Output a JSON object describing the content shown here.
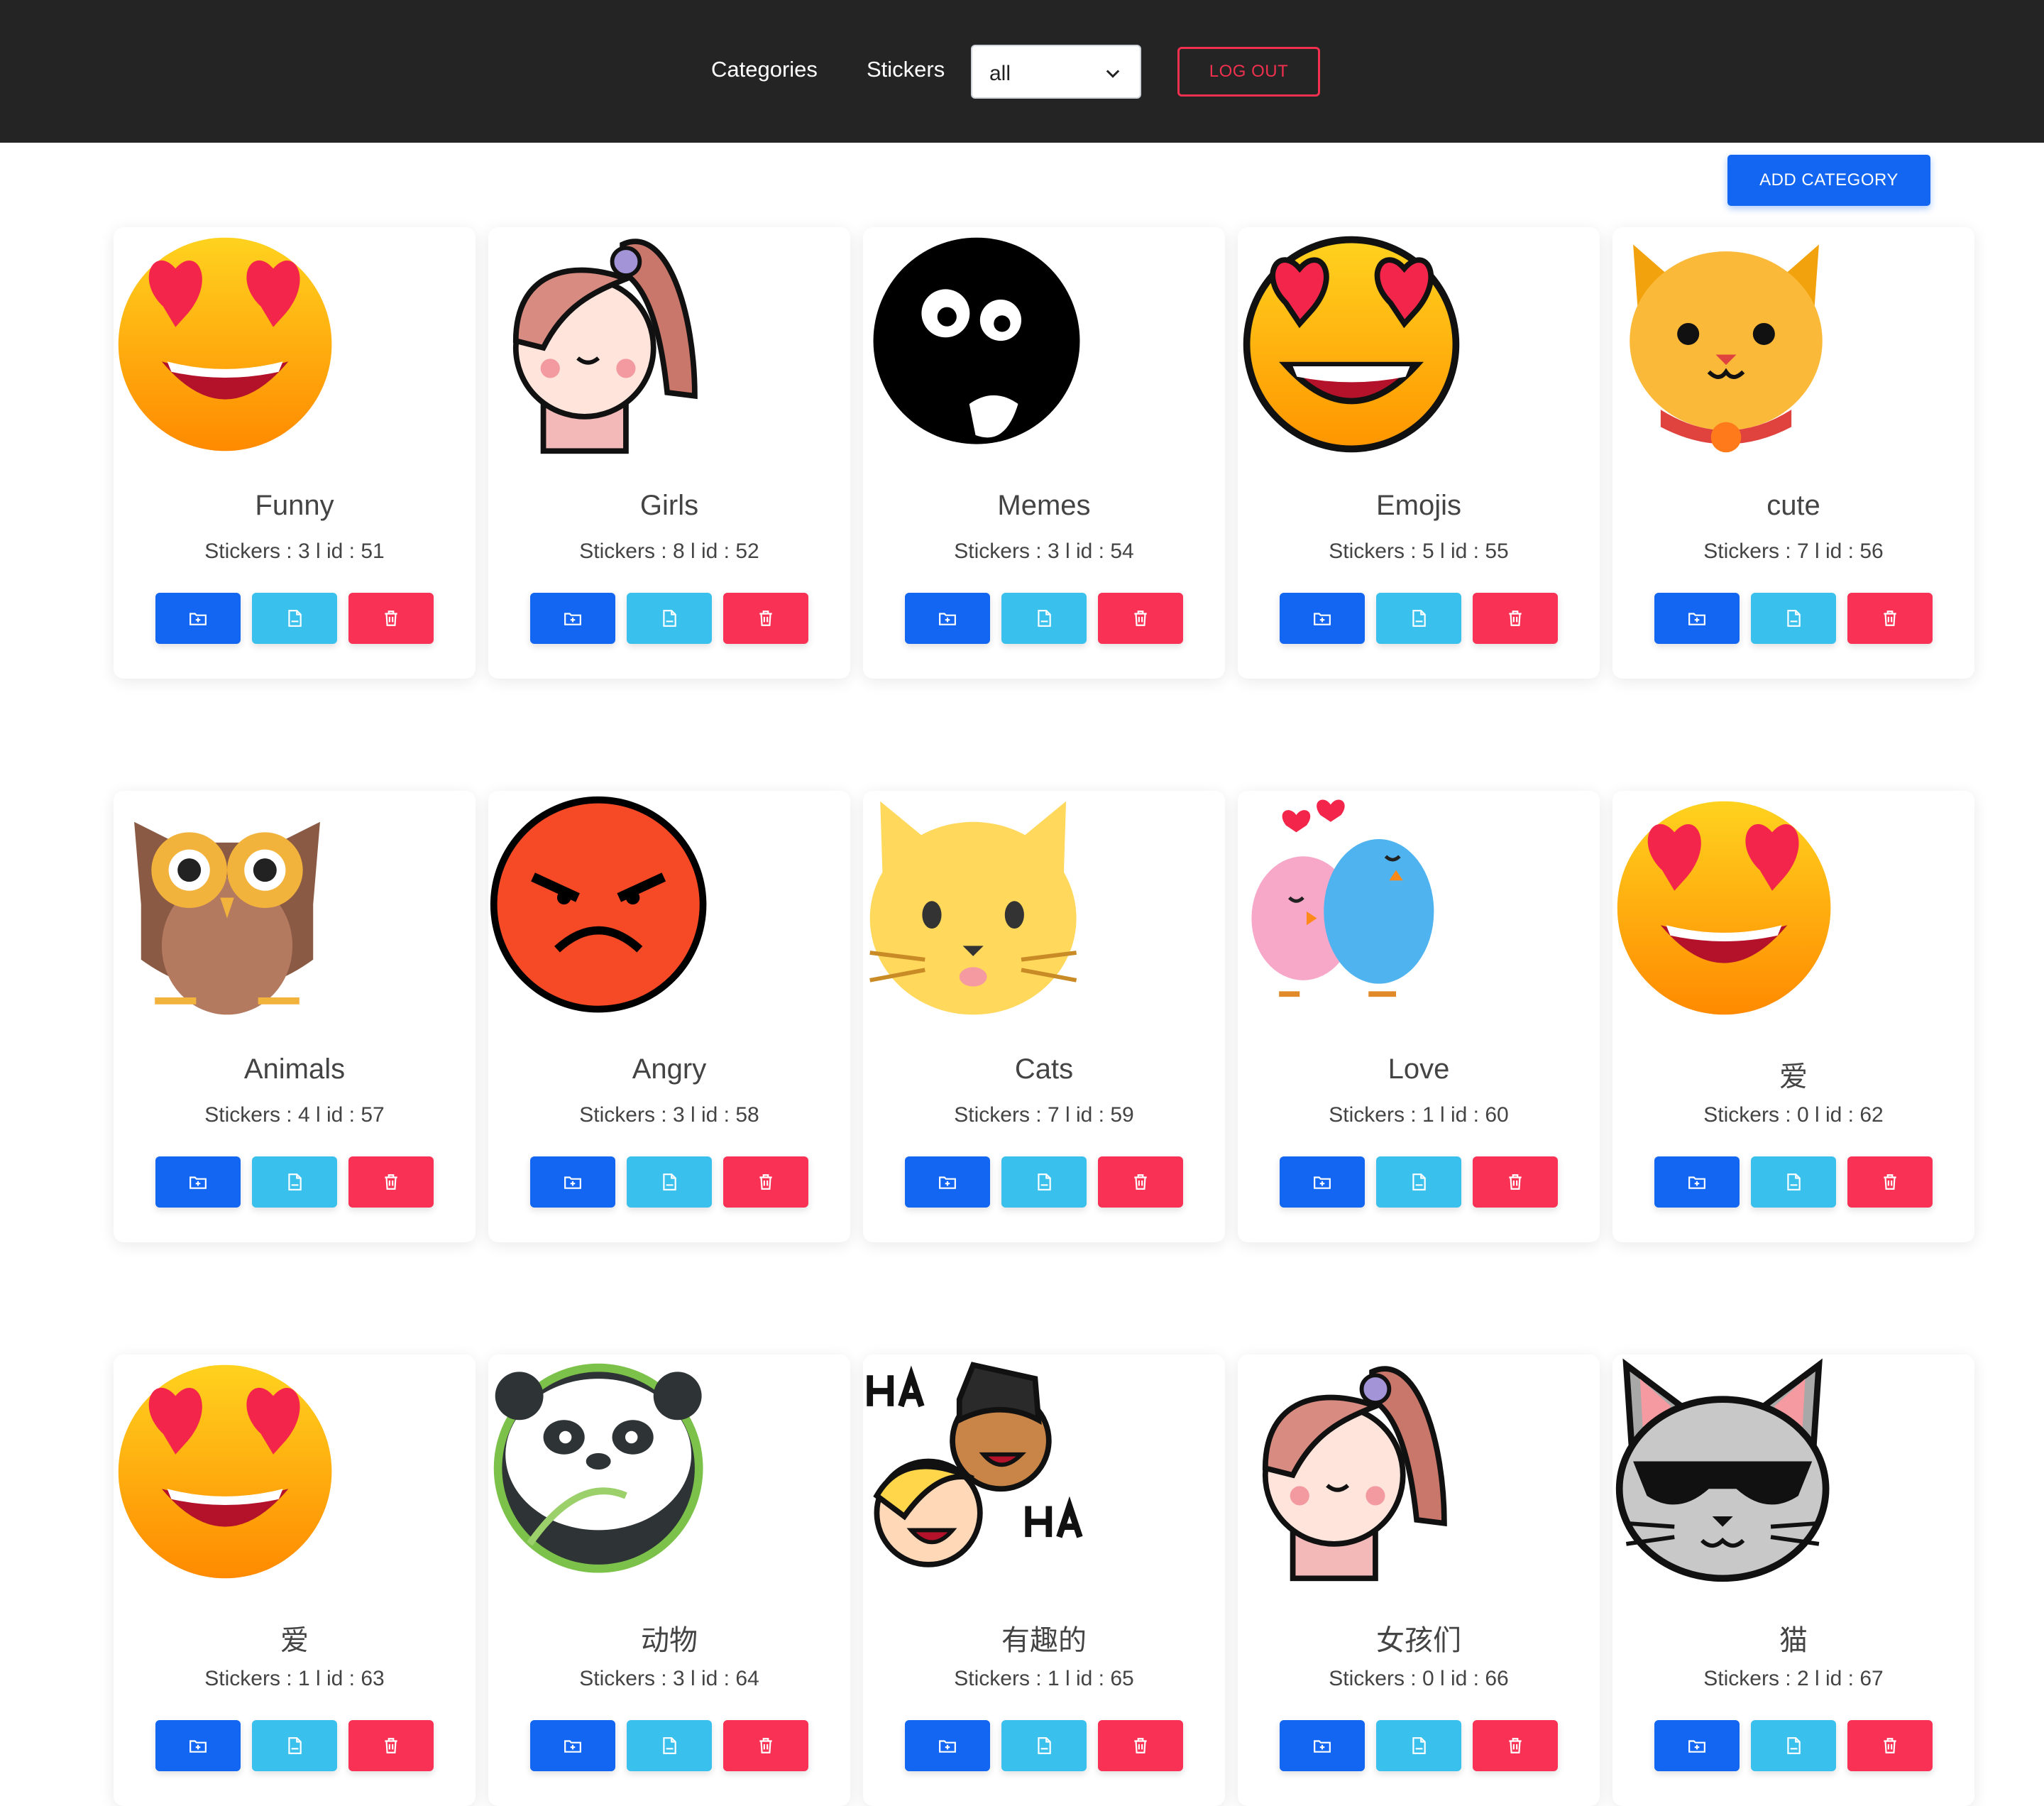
{
  "nav": {
    "categories_label": "Categories",
    "stickers_label": "Stickers",
    "filter_value": "all",
    "logout_label": "LOG OUT"
  },
  "add_category_label": "ADD CATEGORY",
  "colors": {
    "primary": "#1266f1",
    "info": "#39c0ed",
    "danger": "#f93154",
    "navbar": "#242424"
  },
  "cards": [
    {
      "name": "Funny",
      "meta": "Stickers : 3 l id : 51",
      "icon": "heart-eyes-emoji-icon"
    },
    {
      "name": "Girls",
      "meta": "Stickers : 8 l id : 52",
      "icon": "girl-ponytail-icon"
    },
    {
      "name": "Memes",
      "meta": "Stickers : 3 l id : 54",
      "icon": "black-blob-tongue-icon"
    },
    {
      "name": "Emojis",
      "meta": "Stickers : 5 l id : 55",
      "icon": "heart-eyes-outlined-emoji-icon"
    },
    {
      "name": "cute",
      "meta": "Stickers : 7 l id : 56",
      "icon": "cat-face-collar-icon"
    },
    {
      "name": "Animals",
      "meta": "Stickers : 4 l id : 57",
      "icon": "owl-icon"
    },
    {
      "name": "Angry",
      "meta": "Stickers : 3 l id : 58",
      "icon": "angry-face-icon"
    },
    {
      "name": "Cats",
      "meta": "Stickers : 7 l id : 59",
      "icon": "yellow-cat-icon"
    },
    {
      "name": "Love",
      "meta": "Stickers : 1 l id : 60",
      "icon": "love-birds-icon"
    },
    {
      "name": "爱",
      "meta": "Stickers : 0 l id : 62",
      "icon": "heart-eyes-emoji-icon"
    },
    {
      "name": "爱",
      "meta": "Stickers : 1 l id : 63",
      "icon": "heart-eyes-emoji-icon"
    },
    {
      "name": "动物",
      "meta": "Stickers : 3 l id : 64",
      "icon": "panda-icon"
    },
    {
      "name": "有趣的",
      "meta": "Stickers : 1 l id : 65",
      "icon": "laughing-friends-icon"
    },
    {
      "name": "女孩们",
      "meta": "Stickers : 0 l id : 66",
      "icon": "girl-ponytail-icon"
    },
    {
      "name": "猫",
      "meta": "Stickers : 2 l id : 67",
      "icon": "cool-cat-sunglasses-icon"
    }
  ],
  "button_icons": {
    "add": "folder-plus-icon",
    "json": "json-file-icon",
    "delete": "trash-icon"
  }
}
